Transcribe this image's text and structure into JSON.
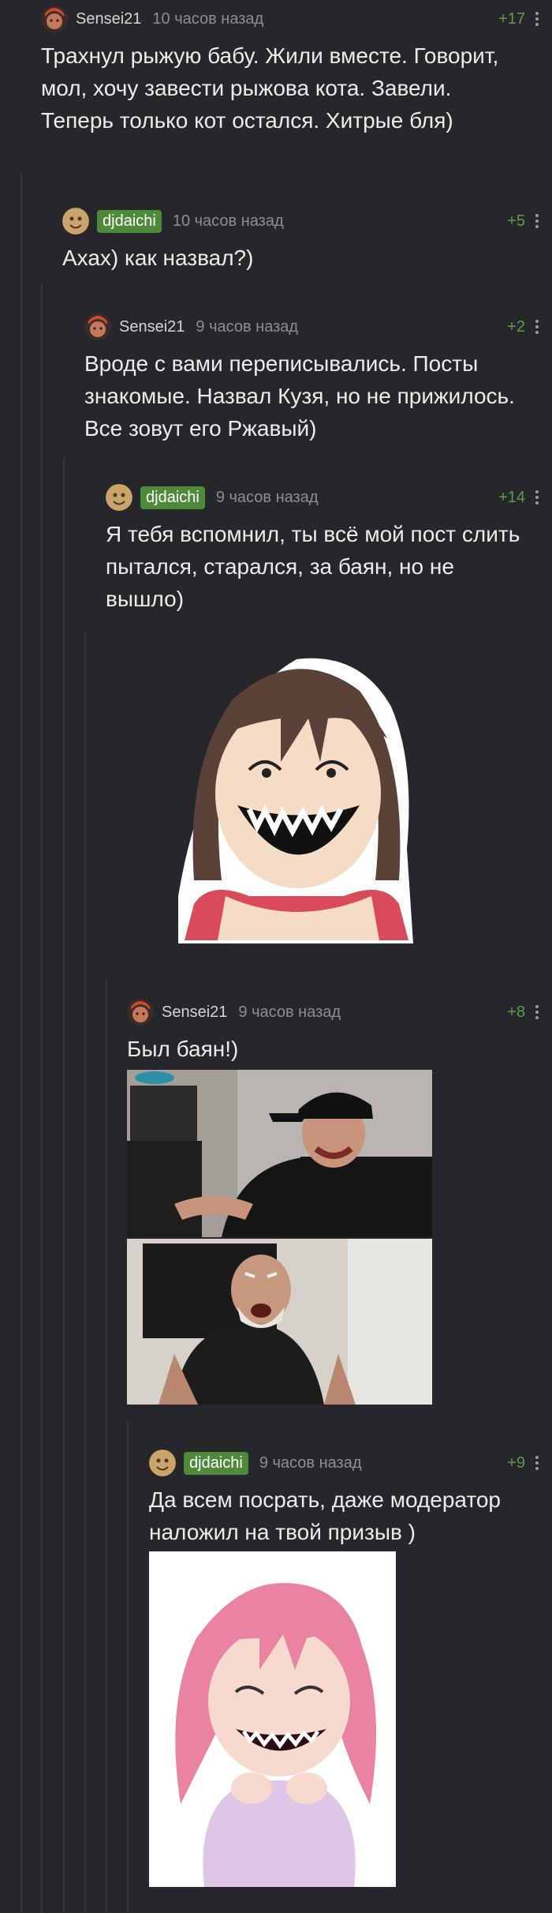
{
  "colors": {
    "background": "#25272b",
    "rating": "#5e9b4c",
    "badge": "#4f8a3a",
    "time": "#8b8e93"
  },
  "comments": [
    {
      "nick": "Sensei21",
      "time": "10 часов назад",
      "rating": "+17",
      "text": "Трахнул рыжую бабу. Жили вместе. Говорит, мол, хочу завести рыжова кота. Завели. Теперь только кот остался. Хитрые бля)"
    },
    {
      "nick": "djdaichi",
      "time": "10 часов назад",
      "rating": "+5",
      "text": "Ахах) как назвал?)"
    },
    {
      "nick": "Sensei21",
      "time": "9 часов назад",
      "rating": "+2",
      "text": "Вроде с вами переписывались. Посты знакомые. Назвал Кузя, но не прижилось. Все зовут его Ржавый)"
    },
    {
      "nick": "djdaichi",
      "time": "9 часов назад",
      "rating": "+14",
      "text": "Я тебя вспомнил, ты всё мой пост слить пытался, старался, за баян, но не вышло)"
    },
    {
      "nick": "Sensei21",
      "time": "9 часов назад",
      "rating": "+8",
      "text": "Был баян!)"
    },
    {
      "nick": "djdaichi",
      "time": "9 часов назад",
      "rating": "+9",
      "text": "Да всем посрать, даже модератор наложил на твой призыв )"
    }
  ],
  "icons": {
    "menu": "more-vertical-icon",
    "avatar_sensei": "avatar-icon",
    "avatar_dj": "avatar-icon"
  }
}
